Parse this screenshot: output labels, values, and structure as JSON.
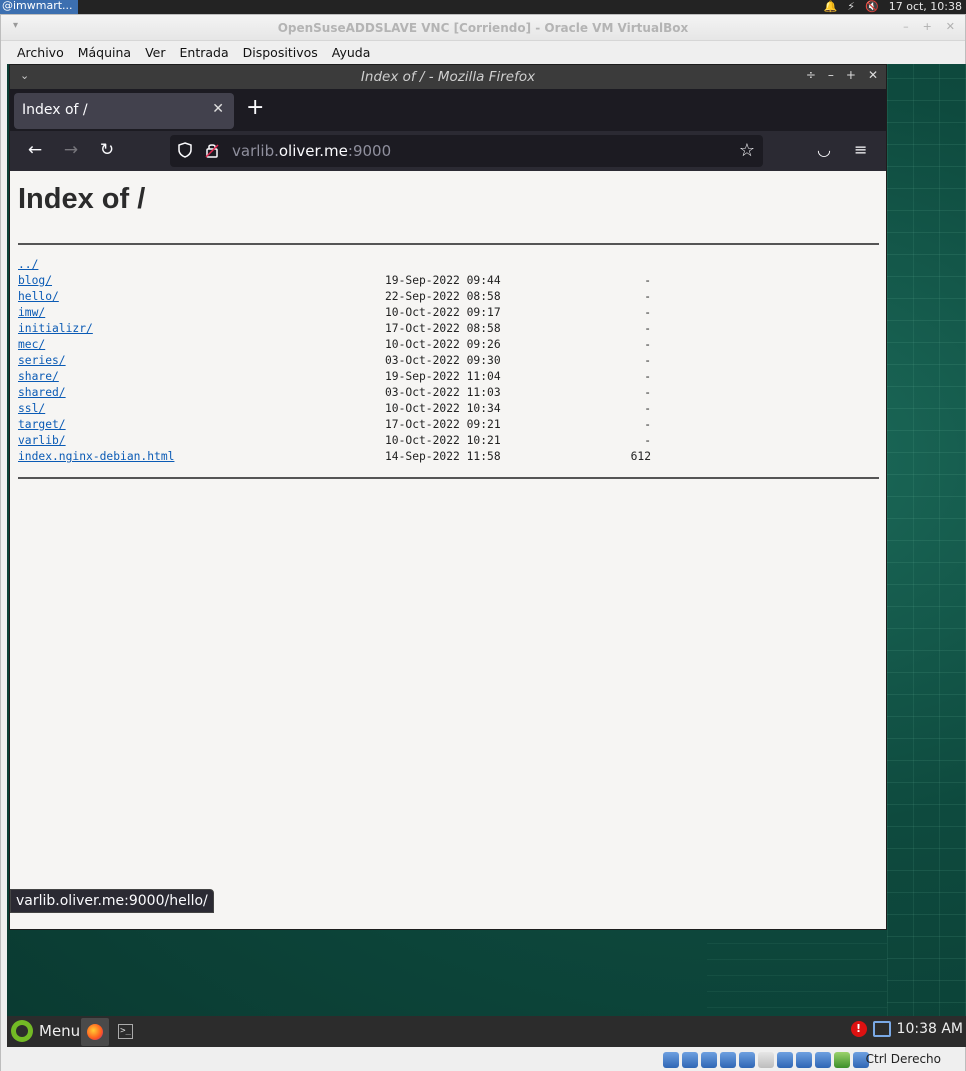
{
  "host_panel": {
    "task_label": "@imwmart...",
    "clock": "17 oct, 10:38"
  },
  "vbox": {
    "title": "OpenSuseADDSLAVE VNC [Corriendo] - Oracle VM VirtualBox",
    "menu": [
      "Archivo",
      "Máquina",
      "Ver",
      "Entrada",
      "Dispositivos",
      "Ayuda"
    ],
    "host_key": "Ctrl Derecho"
  },
  "firefox": {
    "window_title": "Index of / - Mozilla Firefox",
    "tab_title": "Index of /",
    "url": {
      "prefix": "varlib.",
      "host": "oliver.me",
      "suffix": ":9000"
    },
    "status_url": "varlib.oliver.me:9000/hello/"
  },
  "page": {
    "heading": "Index of /",
    "parent_link": "../",
    "entries": [
      {
        "name": "blog/",
        "date": "19-Sep-2022 09:44",
        "size": "-"
      },
      {
        "name": "hello/",
        "date": "22-Sep-2022 08:58",
        "size": "-"
      },
      {
        "name": "imw/",
        "date": "10-Oct-2022 09:17",
        "size": "-"
      },
      {
        "name": "initializr/",
        "date": "17-Oct-2022 08:58",
        "size": "-"
      },
      {
        "name": "mec/",
        "date": "10-Oct-2022 09:26",
        "size": "-"
      },
      {
        "name": "series/",
        "date": "03-Oct-2022 09:30",
        "size": "-"
      },
      {
        "name": "share/",
        "date": "19-Sep-2022 11:04",
        "size": "-"
      },
      {
        "name": "shared/",
        "date": "03-Oct-2022 11:03",
        "size": "-"
      },
      {
        "name": "ssl/",
        "date": "10-Oct-2022 10:34",
        "size": "-"
      },
      {
        "name": "target/",
        "date": "17-Oct-2022 09:21",
        "size": "-"
      },
      {
        "name": "varlib/",
        "date": "10-Oct-2022 10:21",
        "size": "-"
      },
      {
        "name": "index.nginx-debian.html",
        "date": "14-Sep-2022 11:58",
        "size": "612"
      }
    ]
  },
  "guest_panel": {
    "menu_label": "Menu",
    "clock": "10:38 AM"
  },
  "colors": {
    "link": "#0b5bb5",
    "firefox_chrome": "#2b2a33",
    "firefox_tabbar": "#1c1b22",
    "guest_bg": "#0e4a3e",
    "opensuse_green": "#73ba25"
  },
  "icons": [
    "bell-icon",
    "power-icon",
    "mute-icon",
    "back-icon",
    "forward-icon",
    "reload-icon",
    "shield-icon",
    "lock-icon",
    "star-icon",
    "pocket-icon",
    "hamburger-menu-icon",
    "close-tab-icon",
    "new-tab-icon",
    "firefox-icon",
    "terminal-icon",
    "update-alert-icon",
    "network-icon"
  ]
}
